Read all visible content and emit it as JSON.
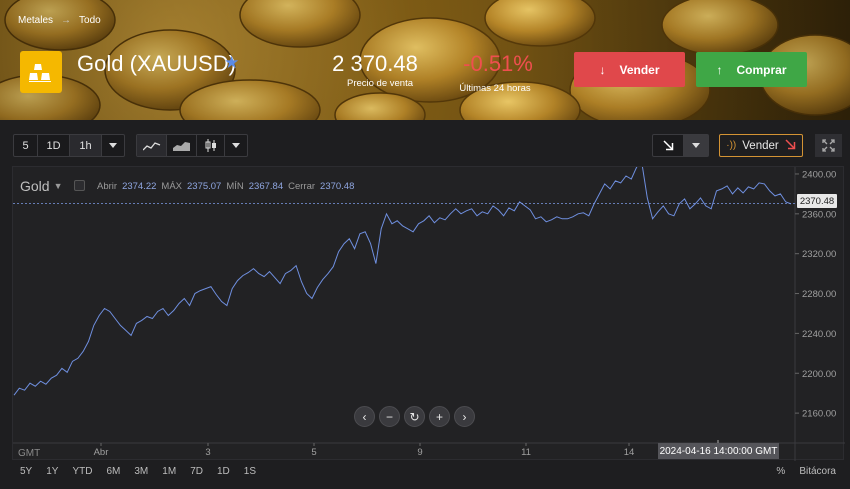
{
  "breadcrumb": {
    "level1": "Metales",
    "level2": "Todo"
  },
  "asset": {
    "name": "Gold (XAUUSD)",
    "price": "2 370.48",
    "price_label": "Precio de venta",
    "change": "-0.51%",
    "change_label": "Últimas 24 horas"
  },
  "actions": {
    "sell": "Vender",
    "buy": "Comprar"
  },
  "toolbar": {
    "interval_a": "5",
    "interval_b": "1D",
    "interval_c": "1h",
    "sell_small": "Vender"
  },
  "chart": {
    "symbol": "Gold",
    "ohlc": {
      "open_label": "Abrir",
      "open": "2374.22",
      "high_label": "MÁX",
      "high": "2375.07",
      "low_label": "MÍN",
      "low": "2367.84",
      "close_label": "Cerrar",
      "close": "2370.48"
    },
    "current_price_tag": "2370.48",
    "crosshair_date": "2024-04-16 14:00:00 GMT",
    "timezone": "GMT"
  },
  "chart_data": {
    "type": "line",
    "x_ticks": [
      "Abr",
      "3",
      "5",
      "9",
      "11",
      "14"
    ],
    "y_ticks": [
      2400,
      2360,
      2320,
      2280,
      2240,
      2200,
      2160
    ],
    "ylim": [
      2130,
      2407
    ],
    "series": [
      {
        "values": [
          2178,
          2185,
          2183,
          2190,
          2187,
          2192,
          2189,
          2195,
          2198,
          2205,
          2201,
          2212,
          2215,
          2222,
          2232,
          2248,
          2258,
          2265,
          2262,
          2255,
          2248,
          2243,
          2238,
          2250,
          2253,
          2257,
          2255,
          2262,
          2265,
          2258,
          2263,
          2270,
          2275,
          2268,
          2280,
          2283,
          2285,
          2287,
          2279,
          2272,
          2268,
          2285,
          2293,
          2298,
          2301,
          2305,
          2300,
          2297,
          2302,
          2296,
          2290,
          2300,
          2303,
          2308,
          2292,
          2280,
          2275,
          2286,
          2294,
          2300,
          2307,
          2322,
          2330,
          2335,
          2325,
          2340,
          2342,
          2330,
          2310,
          2345,
          2360,
          2350,
          2353,
          2348,
          2345,
          2342,
          2350,
          2353,
          2358,
          2351,
          2356,
          2354,
          2360,
          2365,
          2360,
          2363,
          2365,
          2358,
          2362,
          2360,
          2368,
          2364,
          2358,
          2366,
          2363,
          2372,
          2368,
          2364,
          2355,
          2357,
          2352,
          2354,
          2357,
          2355,
          2355,
          2357,
          2360,
          2361,
          2358,
          2370,
          2380,
          2390,
          2385,
          2393,
          2391,
          2398,
          2395,
          2407,
          2410,
          2376,
          2355,
          2362,
          2368,
          2360,
          2358,
          2370,
          2375,
          2365,
          2370,
          2376,
          2368,
          2365,
          2383,
          2385,
          2388,
          2380,
          2386,
          2381,
          2387,
          2385,
          2391,
          2390,
          2383,
          2378,
          2380,
          2372,
          2370
        ],
        "color": "#6f8fdf"
      }
    ],
    "grid": false
  },
  "ranges": [
    "5Y",
    "1Y",
    "YTD",
    "6M",
    "3M",
    "1M",
    "7D",
    "1D",
    "1S"
  ],
  "bottom_right": {
    "percent": "%",
    "log": "Bitácora"
  },
  "colors": {
    "sell": "#e0484b",
    "buy": "#3fa746",
    "accent": "#5c8be6",
    "negative": "#ef4f4f"
  }
}
